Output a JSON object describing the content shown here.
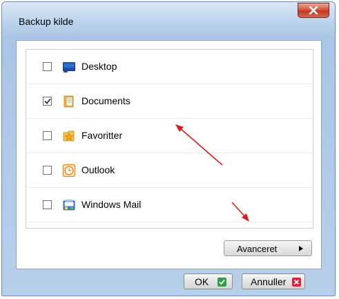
{
  "window": {
    "title": "Backup kilde",
    "close_glyph": "✕"
  },
  "sources": [
    {
      "label": "Desktop",
      "checked": false,
      "icon": "desktop-icon"
    },
    {
      "label": "Documents",
      "checked": true,
      "icon": "documents-folder-icon"
    },
    {
      "label": "Favoritter",
      "checked": false,
      "icon": "favorites-folder-icon"
    },
    {
      "label": "Outlook",
      "checked": false,
      "icon": "outlook-icon"
    },
    {
      "label": "Windows Mail",
      "checked": false,
      "icon": "windows-mail-icon"
    }
  ],
  "buttons": {
    "advanced": "Avanceret",
    "ok": "OK",
    "cancel": "Annuller"
  },
  "colors": {
    "ok_icon": "#2ea043",
    "cancel_icon": "#d8263a",
    "annotation_arrow": "#e01b1b"
  }
}
